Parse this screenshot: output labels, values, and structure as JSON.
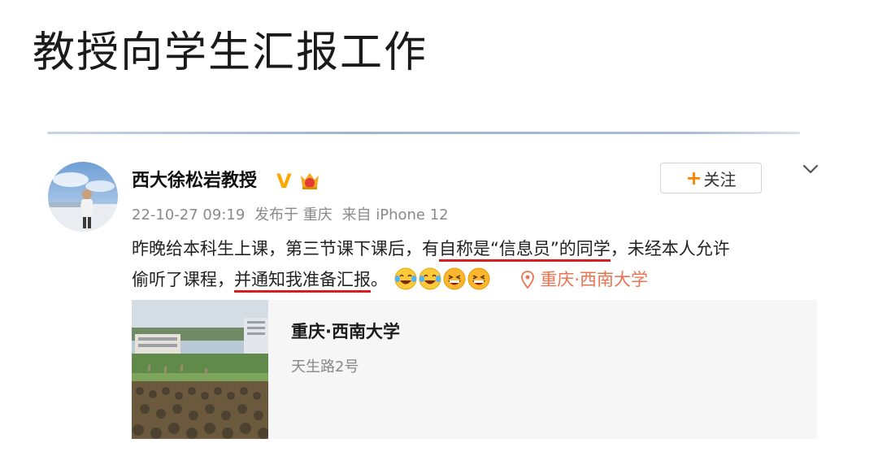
{
  "slide": {
    "title": "教授向学生汇报工作"
  },
  "post": {
    "author": "西大徐松岩教授",
    "verified_mark": "V",
    "follow_button": {
      "plus": "+",
      "label": "关注"
    },
    "meta": {
      "time": "22-10-27 09:19",
      "published_at": "发布于 重庆",
      "source": "来自 iPhone 12"
    },
    "text": {
      "line1_a": "昨晚给本科生上课，第三节课下课后，有",
      "line1_underlined": "自称是“信息员”的同学",
      "line1_b": "，未经本人允许",
      "line2_a": "偷听了课程，",
      "line2_underlined": "并通知我准备汇报",
      "line2_b": "。"
    },
    "emojis": [
      "laugh-cry-emoji",
      "laugh-cry-emoji",
      "grin-emoji",
      "grin-emoji"
    ],
    "location_label": "重庆·西南大学",
    "location_card": {
      "title": "重庆·西南大学",
      "address": "天生路2号"
    }
  },
  "colors": {
    "underline": "#d81e1e",
    "location": "#eb7350",
    "follow_plus": "#ff8200",
    "verified": "#ffa500",
    "meta": "#8a8a8a"
  }
}
